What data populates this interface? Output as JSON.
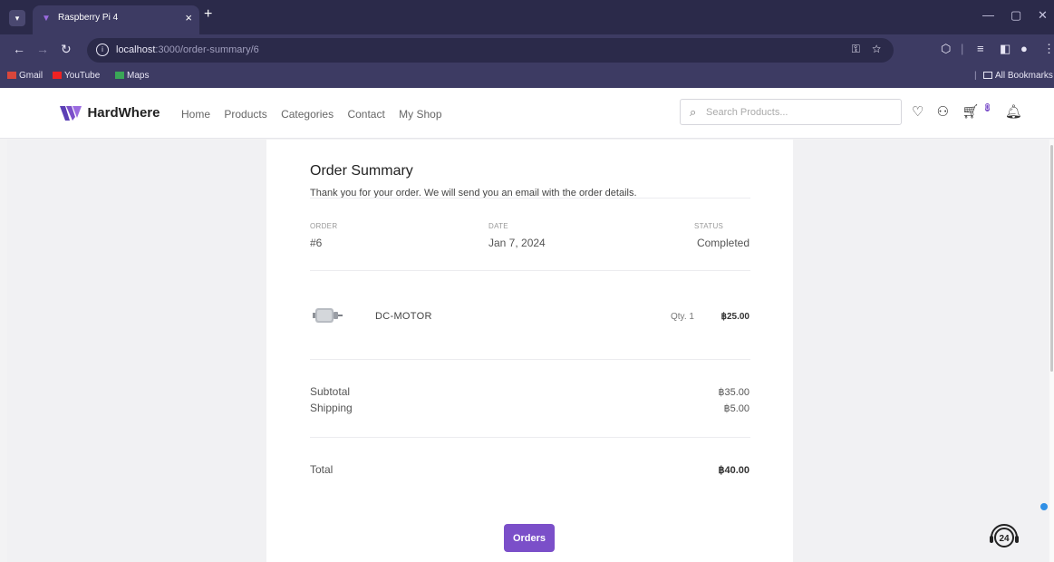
{
  "browser": {
    "tab_title": "Raspberry Pi 4",
    "url_host": "localhost",
    "url_rest": ":3000/order-summary/6",
    "bookmarks": [
      "Gmail",
      "YouTube",
      "Maps"
    ],
    "all_bookmarks": "All Bookmarks"
  },
  "site": {
    "brand": "HardWhere",
    "nav": [
      "Home",
      "Products",
      "Categories",
      "Contact",
      "My Shop"
    ],
    "search_placeholder": "Search Products...",
    "cart_count": "0"
  },
  "order": {
    "title": "Order Summary",
    "message": "Thank you for your order. We will send you an email with the order details.",
    "labels": {
      "order": "ORDER",
      "date": "DATE",
      "status": "STATUS"
    },
    "number": "#6",
    "date": "Jan 7, 2024",
    "status": "Completed",
    "item": {
      "name": "DC-MOTOR",
      "qty": "Qty. 1",
      "price": "฿25.00"
    },
    "subtotal_label": "Subtotal",
    "subtotal": "฿35.00",
    "shipping_label": "Shipping",
    "shipping": "฿5.00",
    "total_label": "Total",
    "total": "฿40.00",
    "orders_button": "Orders"
  },
  "colors": {
    "accent": "#7b4fc9",
    "chrome_dark": "#2b2a4a",
    "chrome": "#3d3b63"
  }
}
